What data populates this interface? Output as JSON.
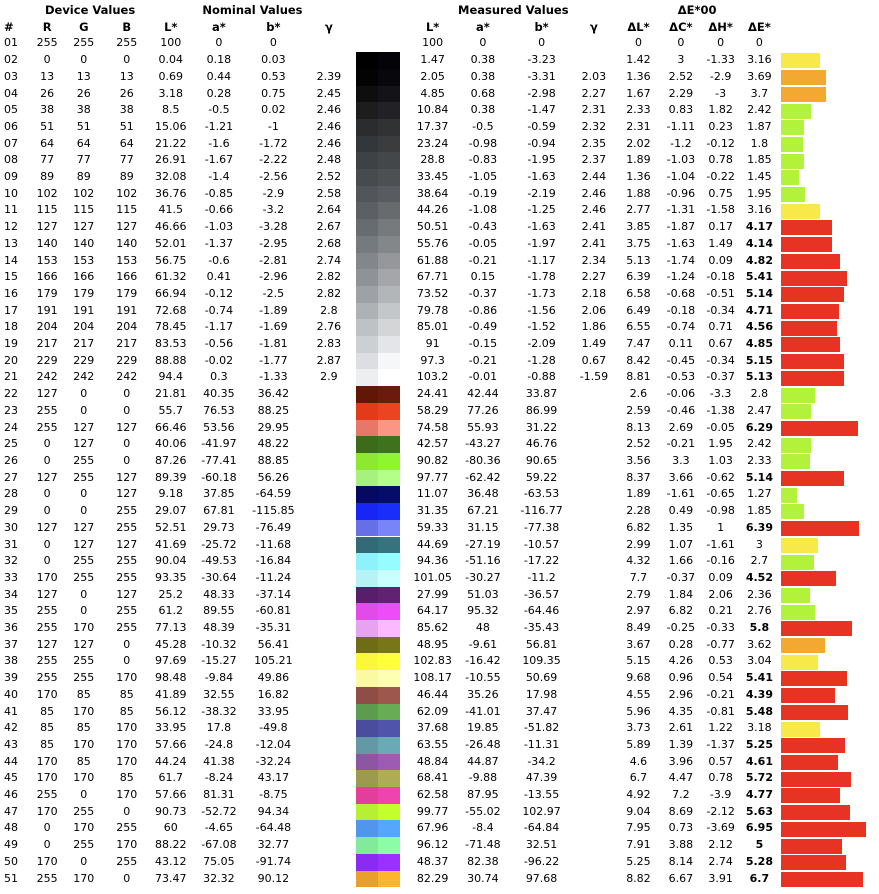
{
  "headers": {
    "device_values": "Device Values",
    "nominal_values": "Nominal Values",
    "measured_values": "Measured Values",
    "delta_e_title": "ΔE*00",
    "cols": [
      "#",
      "R",
      "G",
      "B",
      "L*",
      "a*",
      "b*",
      "γ",
      "L*",
      "a*",
      "b*",
      "γ",
      "ΔL*",
      "ΔC*",
      "ΔH*",
      "ΔE*"
    ]
  },
  "thresholds": {
    "bad_at_or_above": 4
  },
  "colors": {
    "good_text": "#58a832",
    "bad_text": "#e63324",
    "bar_lime": "#b3f23a",
    "bar_yellow": "#f8e84a",
    "bar_orange": "#f2a831",
    "bar_red": "#e63324"
  },
  "rows": [
    {
      "id": "01",
      "r": "255",
      "g": "255",
      "b": "255",
      "nl": "100",
      "na": "0",
      "nb": "0",
      "ng": "",
      "ml": "100",
      "ma": "0",
      "mb": "0",
      "mg": "",
      "dl": "0",
      "dc": "0",
      "dh": "0",
      "de": "0",
      "c1": "#ffffff",
      "c2": "#ffffff"
    },
    {
      "id": "02",
      "r": "0",
      "g": "0",
      "b": "0",
      "nl": "0.04",
      "na": "0.18",
      "nb": "0.03",
      "ng": "",
      "ml": "1.47",
      "ma": "0.38",
      "mb": "-3.23",
      "mg": "",
      "dl": "1.42",
      "dc": "3",
      "dh": "-1.33",
      "de": "3.16",
      "c1": "#000000",
      "c2": "#040408"
    },
    {
      "id": "03",
      "r": "13",
      "g": "13",
      "b": "13",
      "nl": "0.69",
      "na": "0.44",
      "nb": "0.53",
      "ng": "2.39",
      "ml": "2.05",
      "ma": "0.38",
      "mb": "-3.31",
      "mg": "2.03",
      "dl": "1.36",
      "dc": "2.52",
      "dh": "-2.9",
      "de": "3.69",
      "c1": "#030303",
      "c2": "#07070c"
    },
    {
      "id": "04",
      "r": "26",
      "g": "26",
      "b": "26",
      "nl": "3.18",
      "na": "0.28",
      "nb": "0.75",
      "ng": "2.45",
      "ml": "4.85",
      "ma": "0.68",
      "mb": "-2.98",
      "mg": "2.27",
      "dl": "1.67",
      "dc": "2.29",
      "dh": "-3",
      "de": "3.7",
      "c1": "#0e0e0e",
      "c2": "#131318"
    },
    {
      "id": "05",
      "r": "38",
      "g": "38",
      "b": "38",
      "nl": "8.5",
      "na": "-0.5",
      "nb": "0.02",
      "ng": "2.46",
      "ml": "10.84",
      "ma": "0.38",
      "mb": "-1.47",
      "mg": "2.31",
      "dl": "2.33",
      "dc": "0.83",
      "dh": "1.82",
      "de": "2.42",
      "c1": "#1d1d1d",
      "c2": "#222226"
    },
    {
      "id": "06",
      "r": "51",
      "g": "51",
      "b": "51",
      "nl": "15.06",
      "na": "-1.21",
      "nb": "-1",
      "ng": "2.46",
      "ml": "17.37",
      "ma": "-0.5",
      "mb": "-0.59",
      "mg": "2.32",
      "dl": "2.31",
      "dc": "-1.11",
      "dh": "0.23",
      "de": "1.87",
      "c1": "#2a2c2e",
      "c2": "#303233"
    },
    {
      "id": "07",
      "r": "64",
      "g": "64",
      "b": "64",
      "nl": "21.22",
      "na": "-1.6",
      "nb": "-1.72",
      "ng": "2.46",
      "ml": "23.24",
      "ma": "-0.98",
      "mb": "-0.94",
      "mg": "2.35",
      "dl": "2.02",
      "dc": "-1.2",
      "dh": "-0.12",
      "de": "1.8",
      "c1": "#343739",
      "c2": "#3a3c3d"
    },
    {
      "id": "08",
      "r": "77",
      "g": "77",
      "b": "77",
      "nl": "26.91",
      "na": "-1.67",
      "nb": "-2.22",
      "ng": "2.48",
      "ml": "28.8",
      "ma": "-0.83",
      "mb": "-1.95",
      "mg": "2.37",
      "dl": "1.89",
      "dc": "-1.03",
      "dh": "0.78",
      "de": "1.85",
      "c1": "#3e4245",
      "c2": "#44474a"
    },
    {
      "id": "09",
      "r": "89",
      "g": "89",
      "b": "89",
      "nl": "32.08",
      "na": "-1.4",
      "nb": "-2.56",
      "ng": "2.52",
      "ml": "33.45",
      "ma": "-1.05",
      "mb": "-1.63",
      "mg": "2.44",
      "dl": "1.36",
      "dc": "-1.04",
      "dh": "-0.22",
      "de": "1.45",
      "c1": "#474b4e",
      "c2": "#4c5052"
    },
    {
      "id": "10",
      "r": "102",
      "g": "102",
      "b": "102",
      "nl": "36.76",
      "na": "-0.85",
      "nb": "-2.9",
      "ng": "2.58",
      "ml": "38.64",
      "ma": "-0.19",
      "mb": "-2.19",
      "mg": "2.46",
      "dl": "1.88",
      "dc": "-0.96",
      "dh": "0.75",
      "de": "1.95",
      "c1": "#52565a",
      "c2": "#585b5f"
    },
    {
      "id": "11",
      "r": "115",
      "g": "115",
      "b": "115",
      "nl": "41.5",
      "na": "-0.66",
      "nb": "-3.2",
      "ng": "2.64",
      "ml": "44.26",
      "ma": "-1.08",
      "mb": "-1.25",
      "mg": "2.46",
      "dl": "2.77",
      "dc": "-1.31",
      "dh": "-1.58",
      "de": "3.16",
      "c1": "#5c6065",
      "c2": "#676b6d"
    },
    {
      "id": "12",
      "r": "127",
      "g": "127",
      "b": "127",
      "nl": "46.66",
      "na": "-1.03",
      "nb": "-3.28",
      "ng": "2.67",
      "ml": "50.51",
      "ma": "-0.43",
      "mb": "-1.63",
      "mg": "2.41",
      "dl": "3.85",
      "dc": "-1.87",
      "dh": "0.17",
      "de": "4.17",
      "c1": "#676c71",
      "c2": "#767a7d"
    },
    {
      "id": "13",
      "r": "140",
      "g": "140",
      "b": "140",
      "nl": "52.01",
      "na": "-1.37",
      "nb": "-2.95",
      "ng": "2.68",
      "ml": "55.76",
      "ma": "-0.05",
      "mb": "-1.97",
      "mg": "2.41",
      "dl": "3.75",
      "dc": "-1.63",
      "dh": "1.49",
      "de": "4.14",
      "c1": "#757a7f",
      "c2": "#84878a"
    },
    {
      "id": "14",
      "r": "153",
      "g": "153",
      "b": "153",
      "nl": "56.75",
      "na": "-0.6",
      "nb": "-2.81",
      "ng": "2.74",
      "ml": "61.88",
      "ma": "-0.21",
      "mb": "-1.17",
      "mg": "2.34",
      "dl": "5.13",
      "dc": "-1.74",
      "dh": "0.09",
      "de": "4.82",
      "c1": "#83878c",
      "c2": "#95979a"
    },
    {
      "id": "15",
      "r": "166",
      "g": "166",
      "b": "166",
      "nl": "61.32",
      "na": "0.41",
      "nb": "-2.96",
      "ng": "2.82",
      "ml": "67.71",
      "ma": "0.15",
      "mb": "-1.78",
      "mg": "2.27",
      "dl": "6.39",
      "dc": "-1.24",
      "dh": "-0.18",
      "de": "5.41",
      "c1": "#8f9398",
      "c2": "#a4a6a9"
    },
    {
      "id": "16",
      "r": "179",
      "g": "179",
      "b": "179",
      "nl": "66.94",
      "na": "-0.12",
      "nb": "-2.5",
      "ng": "2.82",
      "ml": "73.52",
      "ma": "-0.37",
      "mb": "-1.73",
      "mg": "2.18",
      "dl": "6.58",
      "dc": "-0.68",
      "dh": "-0.51",
      "de": "5.14",
      "c1": "#9ea2a6",
      "c2": "#b3b6b8"
    },
    {
      "id": "17",
      "r": "191",
      "g": "191",
      "b": "191",
      "nl": "72.68",
      "na": "-0.74",
      "nb": "-1.89",
      "ng": "2.8",
      "ml": "79.78",
      "ma": "-0.86",
      "mb": "-1.56",
      "mg": "2.06",
      "dl": "6.49",
      "dc": "-0.18",
      "dh": "-0.34",
      "de": "4.71",
      "c1": "#aeb2b5",
      "c2": "#c4c7c9"
    },
    {
      "id": "18",
      "r": "204",
      "g": "204",
      "b": "204",
      "nl": "78.45",
      "na": "-1.17",
      "nb": "-1.69",
      "ng": "2.76",
      "ml": "85.01",
      "ma": "-0.49",
      "mb": "-1.52",
      "mg": "1.86",
      "dl": "6.55",
      "dc": "-0.74",
      "dh": "0.71",
      "de": "4.56",
      "c1": "#bec2c4",
      "c2": "#d3d5d7"
    },
    {
      "id": "19",
      "r": "217",
      "g": "217",
      "b": "217",
      "nl": "83.53",
      "na": "-0.56",
      "nb": "-1.81",
      "ng": "2.83",
      "ml": "91",
      "ma": "-0.15",
      "mb": "-2.09",
      "mg": "1.49",
      "dl": "7.47",
      "dc": "0.11",
      "dh": "0.67",
      "de": "4.85",
      "c1": "#cdd0d3",
      "c2": "#e4e5e8"
    },
    {
      "id": "20",
      "r": "229",
      "g": "229",
      "b": "229",
      "nl": "88.88",
      "na": "-0.02",
      "nb": "-1.77",
      "ng": "2.87",
      "ml": "97.3",
      "ma": "-0.21",
      "mb": "-1.28",
      "mg": "0.67",
      "dl": "8.42",
      "dc": "-0.45",
      "dh": "-0.34",
      "de": "5.15",
      "c1": "#dcdee1",
      "c2": "#f6f7f9"
    },
    {
      "id": "21",
      "r": "242",
      "g": "242",
      "b": "242",
      "nl": "94.4",
      "na": "0.3",
      "nb": "-1.33",
      "ng": "2.9",
      "ml": "103.2",
      "ma": "-0.01",
      "mb": "-0.88",
      "mg": "-1.59",
      "dl": "8.81",
      "dc": "-0.53",
      "dh": "-0.37",
      "de": "5.13",
      "c1": "#eceef0",
      "c2": "#ffffff"
    },
    {
      "id": "22",
      "r": "127",
      "g": "0",
      "b": "0",
      "nl": "21.81",
      "na": "40.35",
      "nb": "36.42",
      "ng": "",
      "ml": "24.41",
      "ma": "42.44",
      "mb": "33.87",
      "mg": "",
      "dl": "2.6",
      "dc": "-0.06",
      "dh": "-3.3",
      "de": "2.8",
      "c1": "#621605",
      "c2": "#6b1a0d"
    },
    {
      "id": "23",
      "r": "255",
      "g": "0",
      "b": "0",
      "nl": "55.7",
      "na": "76.53",
      "nb": "88.25",
      "ng": "",
      "ml": "58.29",
      "ma": "77.26",
      "mb": "86.99",
      "mg": "",
      "dl": "2.59",
      "dc": "-0.46",
      "dh": "-1.38",
      "de": "2.47",
      "c1": "#e33b1a",
      "c2": "#ec4420"
    },
    {
      "id": "24",
      "r": "255",
      "g": "127",
      "b": "127",
      "nl": "66.46",
      "na": "53.56",
      "nb": "29.95",
      "ng": "",
      "ml": "74.58",
      "ma": "55.93",
      "mb": "31.22",
      "mg": "",
      "dl": "8.13",
      "dc": "2.69",
      "dh": "-0.05",
      "de": "6.29",
      "c1": "#e6786a",
      "c2": "#fb9584"
    },
    {
      "id": "25",
      "r": "0",
      "g": "127",
      "b": "0",
      "nl": "40.06",
      "na": "-41.97",
      "nb": "48.22",
      "ng": "",
      "ml": "42.57",
      "ma": "-43.27",
      "mb": "46.76",
      "mg": "",
      "dl": "2.52",
      "dc": "-0.21",
      "dh": "1.95",
      "de": "2.42",
      "c1": "#3c6b1a",
      "c2": "#3e721c"
    },
    {
      "id": "26",
      "r": "0",
      "g": "255",
      "b": "0",
      "nl": "87.26",
      "na": "-77.41",
      "nb": "88.85",
      "ng": "",
      "ml": "90.82",
      "ma": "-80.36",
      "mb": "90.65",
      "mg": "",
      "dl": "3.56",
      "dc": "3.3",
      "dh": "1.03",
      "de": "2.33",
      "c1": "#8ce830",
      "c2": "#90f531"
    },
    {
      "id": "27",
      "r": "127",
      "g": "255",
      "b": "127",
      "nl": "89.39",
      "na": "-60.18",
      "nb": "56.26",
      "ng": "",
      "ml": "97.77",
      "ma": "-62.42",
      "mb": "59.22",
      "mg": "",
      "dl": "8.37",
      "dc": "3.66",
      "dh": "-0.62",
      "de": "5.14",
      "c1": "#a7f27e",
      "c2": "#b4ff88"
    },
    {
      "id": "28",
      "r": "0",
      "g": "0",
      "b": "127",
      "nl": "9.18",
      "na": "37.85",
      "nb": "-64.59",
      "ng": "",
      "ml": "11.07",
      "ma": "36.48",
      "mb": "-63.53",
      "mg": "",
      "dl": "1.89",
      "dc": "-1.61",
      "dh": "-0.65",
      "de": "1.27",
      "c1": "#050a60",
      "c2": "#060d66"
    },
    {
      "id": "29",
      "r": "0",
      "g": "0",
      "b": "255",
      "nl": "29.07",
      "na": "67.81",
      "nb": "-115.85",
      "ng": "",
      "ml": "31.35",
      "ma": "67.21",
      "mb": "-116.77",
      "mg": "",
      "dl": "2.28",
      "dc": "0.49",
      "dh": "-0.98",
      "de": "1.85",
      "c1": "#1726f5",
      "c2": "#1a2efa"
    },
    {
      "id": "30",
      "r": "127",
      "g": "127",
      "b": "255",
      "nl": "52.51",
      "na": "29.73",
      "nb": "-76.49",
      "ng": "",
      "ml": "59.33",
      "ma": "31.15",
      "mb": "-77.38",
      "mg": "",
      "dl": "6.82",
      "dc": "1.35",
      "dh": "1",
      "de": "6.39",
      "c1": "#6570e6",
      "c2": "#7884f8"
    },
    {
      "id": "31",
      "r": "0",
      "g": "127",
      "b": "127",
      "nl": "41.69",
      "na": "-25.72",
      "nb": "-11.68",
      "ng": "",
      "ml": "44.69",
      "ma": "-27.19",
      "mb": "-10.57",
      "mg": "",
      "dl": "2.99",
      "dc": "1.07",
      "dh": "-1.61",
      "de": "3",
      "c1": "#326a78",
      "c2": "#37737e"
    },
    {
      "id": "32",
      "r": "0",
      "g": "255",
      "b": "255",
      "nl": "90.04",
      "na": "-49.53",
      "nb": "-16.84",
      "ng": "",
      "ml": "94.36",
      "ma": "-51.16",
      "mb": "-17.22",
      "mg": "",
      "dl": "4.32",
      "dc": "1.66",
      "dh": "-0.16",
      "de": "2.7",
      "c1": "#8ef2fb",
      "c2": "#95fdff"
    },
    {
      "id": "33",
      "r": "170",
      "g": "255",
      "b": "255",
      "nl": "93.35",
      "na": "-30.64",
      "nb": "-11.24",
      "ng": "",
      "ml": "101.05",
      "ma": "-30.27",
      "mb": "-11.2",
      "mg": "",
      "dl": "7.7",
      "dc": "-0.37",
      "dh": "0.09",
      "de": "4.52",
      "c1": "#b7f2f6",
      "c2": "#caffff"
    },
    {
      "id": "34",
      "r": "127",
      "g": "0",
      "b": "127",
      "nl": "25.2",
      "na": "48.33",
      "nb": "-37.14",
      "ng": "",
      "ml": "27.99",
      "ma": "51.03",
      "mb": "-36.57",
      "mg": "",
      "dl": "2.79",
      "dc": "1.84",
      "dh": "2.06",
      "de": "2.36",
      "c1": "#581e6b",
      "c2": "#612272"
    },
    {
      "id": "35",
      "r": "255",
      "g": "0",
      "b": "255",
      "nl": "61.2",
      "na": "89.55",
      "nb": "-60.81",
      "ng": "",
      "ml": "64.17",
      "ma": "95.32",
      "mb": "-64.46",
      "mg": "",
      "dl": "2.97",
      "dc": "6.82",
      "dh": "0.21",
      "de": "2.76",
      "c1": "#e24be8",
      "c2": "#ed4df6"
    },
    {
      "id": "36",
      "r": "255",
      "g": "170",
      "b": "255",
      "nl": "77.13",
      "na": "48.39",
      "nb": "-35.31",
      "ng": "",
      "ml": "85.62",
      "ma": "48",
      "mb": "-35.43",
      "mg": "",
      "dl": "8.49",
      "dc": "-0.25",
      "dh": "-0.33",
      "de": "5.8",
      "c1": "#e7a2f0",
      "c2": "#fbb9ff"
    },
    {
      "id": "37",
      "r": "127",
      "g": "127",
      "b": "0",
      "nl": "45.28",
      "na": "-10.32",
      "nb": "56.41",
      "ng": "",
      "ml": "48.95",
      "ma": "-9.61",
      "mb": "56.81",
      "mg": "",
      "dl": "3.67",
      "dc": "0.28",
      "dh": "-0.77",
      "de": "3.62",
      "c1": "#6e6d13",
      "c2": "#777717"
    },
    {
      "id": "38",
      "r": "255",
      "g": "255",
      "b": "0",
      "nl": "97.69",
      "na": "-15.27",
      "nb": "105.21",
      "ng": "",
      "ml": "102.83",
      "ma": "-16.42",
      "mb": "109.35",
      "mg": "",
      "dl": "5.15",
      "dc": "4.26",
      "dh": "0.53",
      "de": "3.04",
      "c1": "#fbf83b",
      "c2": "#ffff3a"
    },
    {
      "id": "39",
      "r": "255",
      "g": "255",
      "b": "170",
      "nl": "98.48",
      "na": "-9.84",
      "nb": "49.86",
      "ng": "",
      "ml": "108.17",
      "ma": "-10.55",
      "mb": "50.69",
      "mg": "",
      "dl": "9.68",
      "dc": "0.96",
      "dh": "0.54",
      "de": "5.41",
      "c1": "#fbfaa2",
      "c2": "#ffffb1"
    },
    {
      "id": "40",
      "r": "170",
      "g": "85",
      "b": "85",
      "nl": "41.89",
      "na": "32.55",
      "nb": "16.82",
      "ng": "",
      "ml": "46.44",
      "ma": "35.26",
      "mb": "17.98",
      "mg": "",
      "dl": "4.55",
      "dc": "2.96",
      "dh": "-0.21",
      "de": "4.39",
      "c1": "#8f4e45",
      "c2": "#9d574d"
    },
    {
      "id": "41",
      "r": "85",
      "g": "170",
      "b": "85",
      "nl": "56.12",
      "na": "-38.32",
      "nb": "33.95",
      "ng": "",
      "ml": "62.09",
      "ma": "-41.01",
      "mb": "37.47",
      "mg": "",
      "dl": "5.96",
      "dc": "4.35",
      "dh": "-0.81",
      "de": "5.48",
      "c1": "#5d9c4e",
      "c2": "#68ad55"
    },
    {
      "id": "42",
      "r": "85",
      "g": "85",
      "b": "170",
      "nl": "33.95",
      "na": "17.8",
      "nb": "-49.8",
      "ng": "",
      "ml": "37.68",
      "ma": "19.85",
      "mb": "-51.82",
      "mg": "",
      "dl": "3.73",
      "dc": "2.61",
      "dh": "1.22",
      "de": "3.18",
      "c1": "#4a4d9e",
      "c2": "#5154ab"
    },
    {
      "id": "43",
      "r": "85",
      "g": "170",
      "b": "170",
      "nl": "57.66",
      "na": "-24.8",
      "nb": "-12.04",
      "ng": "",
      "ml": "63.55",
      "ma": "-26.48",
      "mb": "-11.31",
      "mg": "",
      "dl": "5.89",
      "dc": "1.39",
      "dh": "-1.37",
      "de": "5.25",
      "c1": "#6399a7",
      "c2": "#6aa9b6"
    },
    {
      "id": "44",
      "r": "170",
      "g": "85",
      "b": "170",
      "nl": "44.24",
      "na": "41.38",
      "nb": "-32.24",
      "ng": "",
      "ml": "48.84",
      "ma": "44.87",
      "mb": "-34.2",
      "mg": "",
      "dl": "4.6",
      "dc": "3.96",
      "dh": "0.57",
      "de": "4.61",
      "c1": "#8e55a2",
      "c2": "#9d5cb4"
    },
    {
      "id": "45",
      "r": "170",
      "g": "170",
      "b": "85",
      "nl": "61.7",
      "na": "-8.24",
      "nb": "43.17",
      "ng": "",
      "ml": "68.41",
      "ma": "-9.88",
      "mb": "47.39",
      "mg": "",
      "dl": "6.7",
      "dc": "4.47",
      "dh": "0.78",
      "de": "5.72",
      "c1": "#9b9a4e",
      "c2": "#aeac56"
    },
    {
      "id": "46",
      "r": "255",
      "g": "0",
      "b": "170",
      "nl": "57.66",
      "na": "81.31",
      "nb": "-8.75",
      "ng": "",
      "ml": "62.58",
      "ma": "87.95",
      "mb": "-13.55",
      "mg": "",
      "dl": "4.92",
      "dc": "7.2",
      "dh": "-3.9",
      "de": "4.77",
      "c1": "#e23e9b",
      "c2": "#ef43ad"
    },
    {
      "id": "47",
      "r": "170",
      "g": "255",
      "b": "0",
      "nl": "90.73",
      "na": "-52.72",
      "nb": "94.34",
      "ng": "",
      "ml": "99.77",
      "ma": "-55.02",
      "mb": "102.97",
      "mg": "",
      "dl": "9.04",
      "dc": "8.69",
      "dh": "-2.12",
      "de": "5.63",
      "c1": "#b7ef33",
      "c2": "#c2ff2c"
    },
    {
      "id": "48",
      "r": "0",
      "g": "170",
      "b": "255",
      "nl": "60",
      "na": "-4.65",
      "nb": "-64.48",
      "ng": "",
      "ml": "67.96",
      "ma": "-8.4",
      "mb": "-64.84",
      "mg": "",
      "dl": "7.95",
      "dc": "0.73",
      "dh": "-3.69",
      "de": "6.95",
      "c1": "#4f96ec",
      "c2": "#55a7fe"
    },
    {
      "id": "49",
      "r": "0",
      "g": "255",
      "b": "170",
      "nl": "88.22",
      "na": "-67.08",
      "nb": "32.77",
      "ng": "",
      "ml": "96.12",
      "ma": "-71.48",
      "mb": "32.51",
      "mg": "",
      "dl": "7.91",
      "dc": "3.88",
      "dh": "2.12",
      "de": "5",
      "c1": "#82eb9b",
      "c2": "#8cfca7"
    },
    {
      "id": "50",
      "r": "170",
      "g": "0",
      "b": "255",
      "nl": "43.12",
      "na": "75.05",
      "nb": "-91.74",
      "ng": "",
      "ml": "48.37",
      "ma": "82.38",
      "mb": "-96.22",
      "mg": "",
      "dl": "5.25",
      "dc": "8.14",
      "dh": "2.74",
      "de": "5.28",
      "c1": "#8b2af1",
      "c2": "#9c30ff"
    },
    {
      "id": "51",
      "r": "255",
      "g": "170",
      "b": "0",
      "nl": "73.47",
      "na": "32.32",
      "nb": "90.12",
      "ng": "",
      "ml": "82.29",
      "ma": "30.74",
      "mb": "97.68",
      "mg": "",
      "dl": "8.82",
      "dc": "6.67",
      "dh": "3.91",
      "de": "6.7",
      "c1": "#e99f2c",
      "c2": "#fcb52c"
    }
  ]
}
